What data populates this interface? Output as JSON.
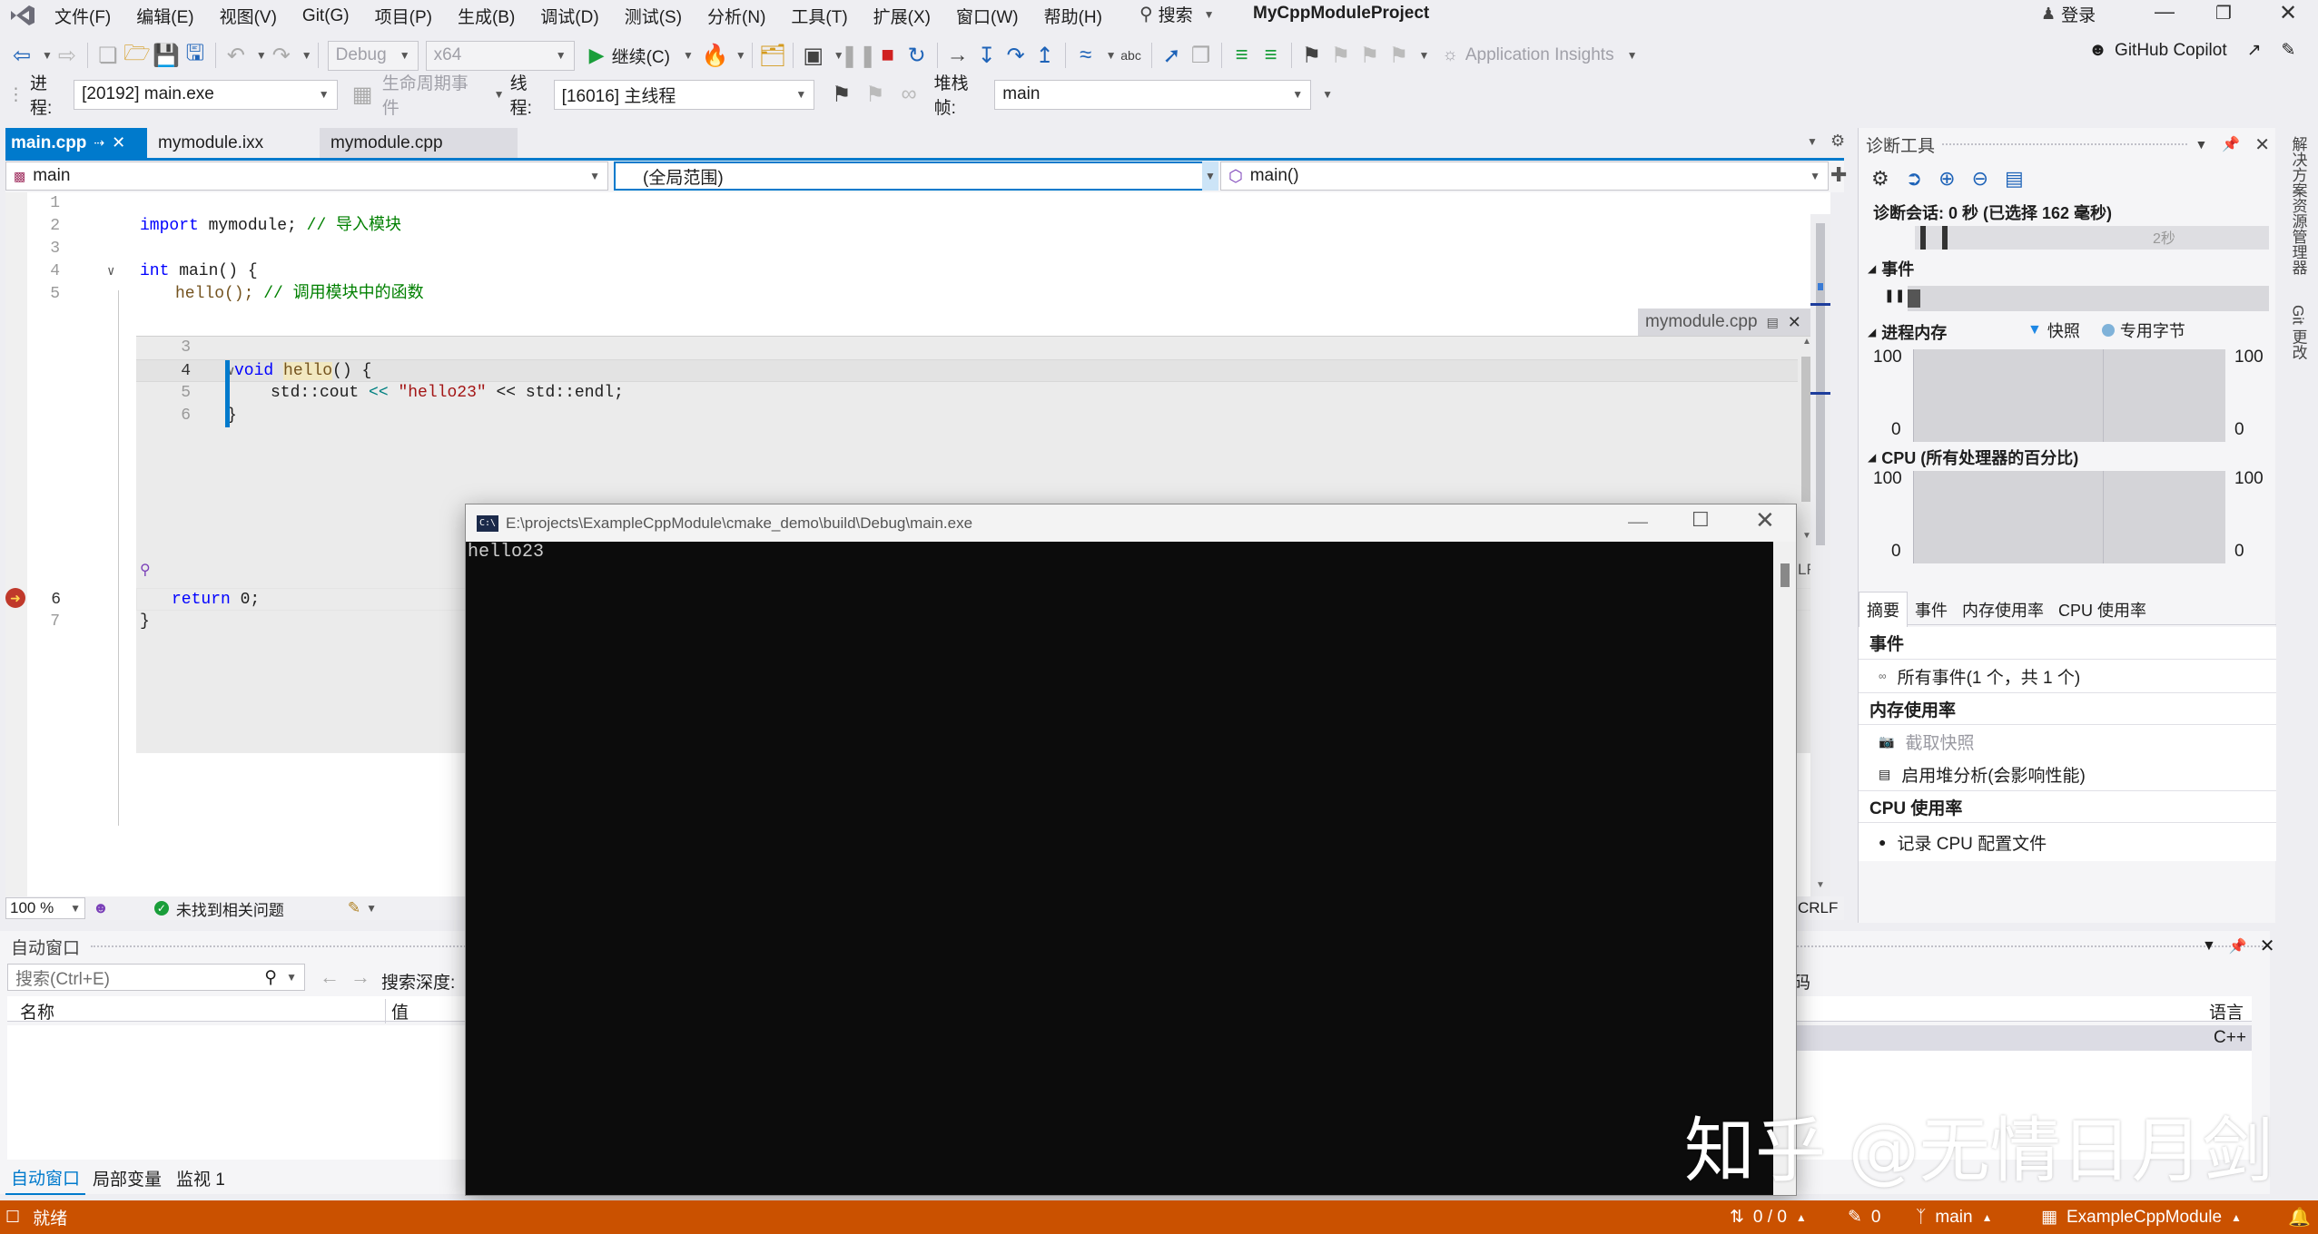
{
  "menu": {
    "items": [
      "文件(F)",
      "编辑(E)",
      "视图(V)",
      "Git(G)",
      "项目(P)",
      "生成(B)",
      "调试(D)",
      "测试(S)",
      "分析(N)",
      "工具(T)",
      "扩展(X)",
      "窗口(W)",
      "帮助(H)"
    ],
    "search": "搜索",
    "project_title": "MyCppModuleProject",
    "login": "登录"
  },
  "toolbar": {
    "config": "Debug",
    "platform": "x64",
    "continue": "继续(C)",
    "app_insights": "Application Insights",
    "copilot": "GitHub Copilot"
  },
  "debugbar": {
    "process_label": "进程:",
    "process_value": "[20192] main.exe",
    "lifecycle": "生命周期事件",
    "thread_label": "线程:",
    "thread_value": "[16016] 主线程",
    "stack_label": "堆栈帧:",
    "stack_value": "main"
  },
  "tabs": [
    {
      "label": "main.cpp",
      "active": true
    },
    {
      "label": "mymodule.ixx",
      "active": false
    },
    {
      "label": "mymodule.cpp",
      "active": false
    }
  ],
  "navbar": {
    "project": "main",
    "scope": "(全局范围)",
    "member": "main()"
  },
  "editor": {
    "lines": [
      {
        "n": "1"
      },
      {
        "n": "2",
        "a": "import",
        "b": " mymodule;  ",
        "c": "// 导入模块"
      },
      {
        "n": "3"
      },
      {
        "n": "4",
        "a": "int",
        "b": " main() {"
      },
      {
        "n": "5",
        "b": "hello();  ",
        "c": "// 调用模块中的函数"
      }
    ],
    "line6": {
      "n": "6",
      "a": "return",
      "b": " 0;"
    },
    "line7": {
      "n": "7",
      "b": "}"
    },
    "peek": {
      "title": "mymodule.cpp",
      "l3": "3",
      "l4": "4",
      "l4_kw": "void",
      "l4_fn": "hello",
      "l4_rest": "() {",
      "l5": "5",
      "l5_a": "std::cout ",
      "l5_op": "<<",
      "l5_str": "\"hello23\"",
      "l5_b": " << std::endl;",
      "l6": "6",
      "l6_rest": "}"
    },
    "zoom": "100 %",
    "issues": "未找到相关问题",
    "crlf": "CRLF",
    "lf": "LF"
  },
  "console": {
    "title": "E:\\projects\\ExampleCppModule\\cmake_demo\\build\\Debug\\main.exe",
    "output": "hello23"
  },
  "autos": {
    "title": "自动窗口",
    "search_placeholder": "搜索(Ctrl+E)",
    "depth": "搜索深度:",
    "col_name": "名称",
    "col_value": "值",
    "col_lang": "语言",
    "code_frag": "码",
    "row_lang": "C++",
    "tabs": [
      "自动窗口",
      "局部变量",
      "监视 1"
    ]
  },
  "diag": {
    "title": "诊断工具",
    "session": "诊断会话: 0 秒 (已选择 162 毫秒)",
    "tick_2s": "2秒",
    "events": "事件",
    "memory": "进程内存",
    "snapshot": "快照",
    "private_bytes": "专用字节",
    "cpu": "CPU (所有处理器的百分比)",
    "mem_max": "100",
    "mem_min": "0",
    "cpu_max": "100",
    "cpu_min": "0",
    "tabs": [
      "摘要",
      "事件",
      "内存使用率",
      "CPU 使用率"
    ],
    "sec_events": "事件",
    "all_events": "所有事件(1 个，共 1 个)",
    "sec_memory": "内存使用率",
    "take_snapshot": "截取快照",
    "heap": "启用堆分析(会影响性能)",
    "sec_cpu": "CPU 使用率",
    "record_cpu": "记录 CPU 配置文件"
  },
  "side_tabs": [
    "解决方案资源管理器",
    "Git 更改"
  ],
  "status": {
    "ready": "就绪",
    "changes": "0 / 0",
    "edits": "0",
    "branch": "main",
    "repo": "ExampleCppModule"
  },
  "watermark": "知乎 @无情日月剑",
  "colors": {
    "accent_blue": "#007acc",
    "status_orange": "#ca5100",
    "console_bg": "#0c0c0c"
  }
}
